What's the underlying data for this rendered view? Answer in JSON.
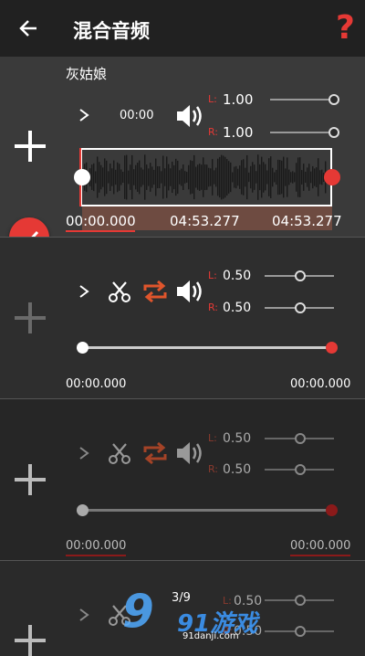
{
  "header": {
    "title": "混合音频",
    "back_icon": "arrow-left-icon",
    "help_icon": "question-icon"
  },
  "tracks": [
    {
      "name": "灰姑娘",
      "position": "00:00",
      "left_label": "L:",
      "right_label": "R:",
      "left_volume": "1.00",
      "right_volume": "1.00",
      "left_level": 0.9,
      "right_level": 0.9,
      "time_start": "00:00.000",
      "time_mid": "04:53.277",
      "time_end": "04:53.277"
    },
    {
      "left_label": "L:",
      "right_label": "R:",
      "left_volume": "0.50",
      "right_volume": "0.50",
      "left_level": 0.5,
      "right_level": 0.5,
      "time_start": "00:00.000",
      "time_end": "00:00.000"
    },
    {
      "left_label": "L:",
      "right_label": "R:",
      "left_volume": "0.50",
      "right_volume": "0.50",
      "left_level": 0.5,
      "right_level": 0.5,
      "time_start": "00:00.000",
      "time_end": "00:00.000"
    },
    {
      "left_label": "L:",
      "right_label": "R:",
      "left_volume": "0.50",
      "right_volume": "0.50",
      "left_level": 0.5,
      "right_level": 0.5
    }
  ],
  "watermark": {
    "count": "3/9",
    "logo_text": "91游戏",
    "domain": "91danji.com"
  },
  "colors": {
    "accent": "#e53935",
    "loop": "#e0552c"
  }
}
